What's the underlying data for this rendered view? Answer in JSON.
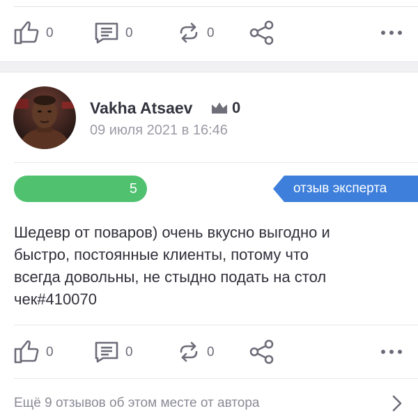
{
  "top_actions": {
    "like_count": "0",
    "comment_count": "0",
    "repost_count": "0"
  },
  "review": {
    "author_name": "Vakha Atsaev",
    "author_score": "0",
    "date": "09 июля 2021 в 16:46",
    "rating": "5",
    "rating_fraction": 1.0,
    "expert_label": "отзыв эксперта",
    "text_lines": [
      "Шедевр от поваров) очень вкусно выгодно и",
      "быстро, постоянные клиенты, потому что",
      "всегда довольны, не стыдно подать на стол",
      "чек#410070"
    ]
  },
  "bottom_actions": {
    "like_count": "0",
    "comment_count": "0",
    "repost_count": "0"
  },
  "more_reviews_label": "Ещё 9 отзывов об этом месте от автора",
  "colors": {
    "rating_green": "#4fc16f",
    "expert_blue": "#3d7fdb",
    "icon_gray": "#6b6b78"
  },
  "icons": [
    "thumbs-up-icon",
    "comment-icon",
    "repost-icon",
    "share-icon",
    "more-icon",
    "crown-icon",
    "chevron-right-icon"
  ]
}
